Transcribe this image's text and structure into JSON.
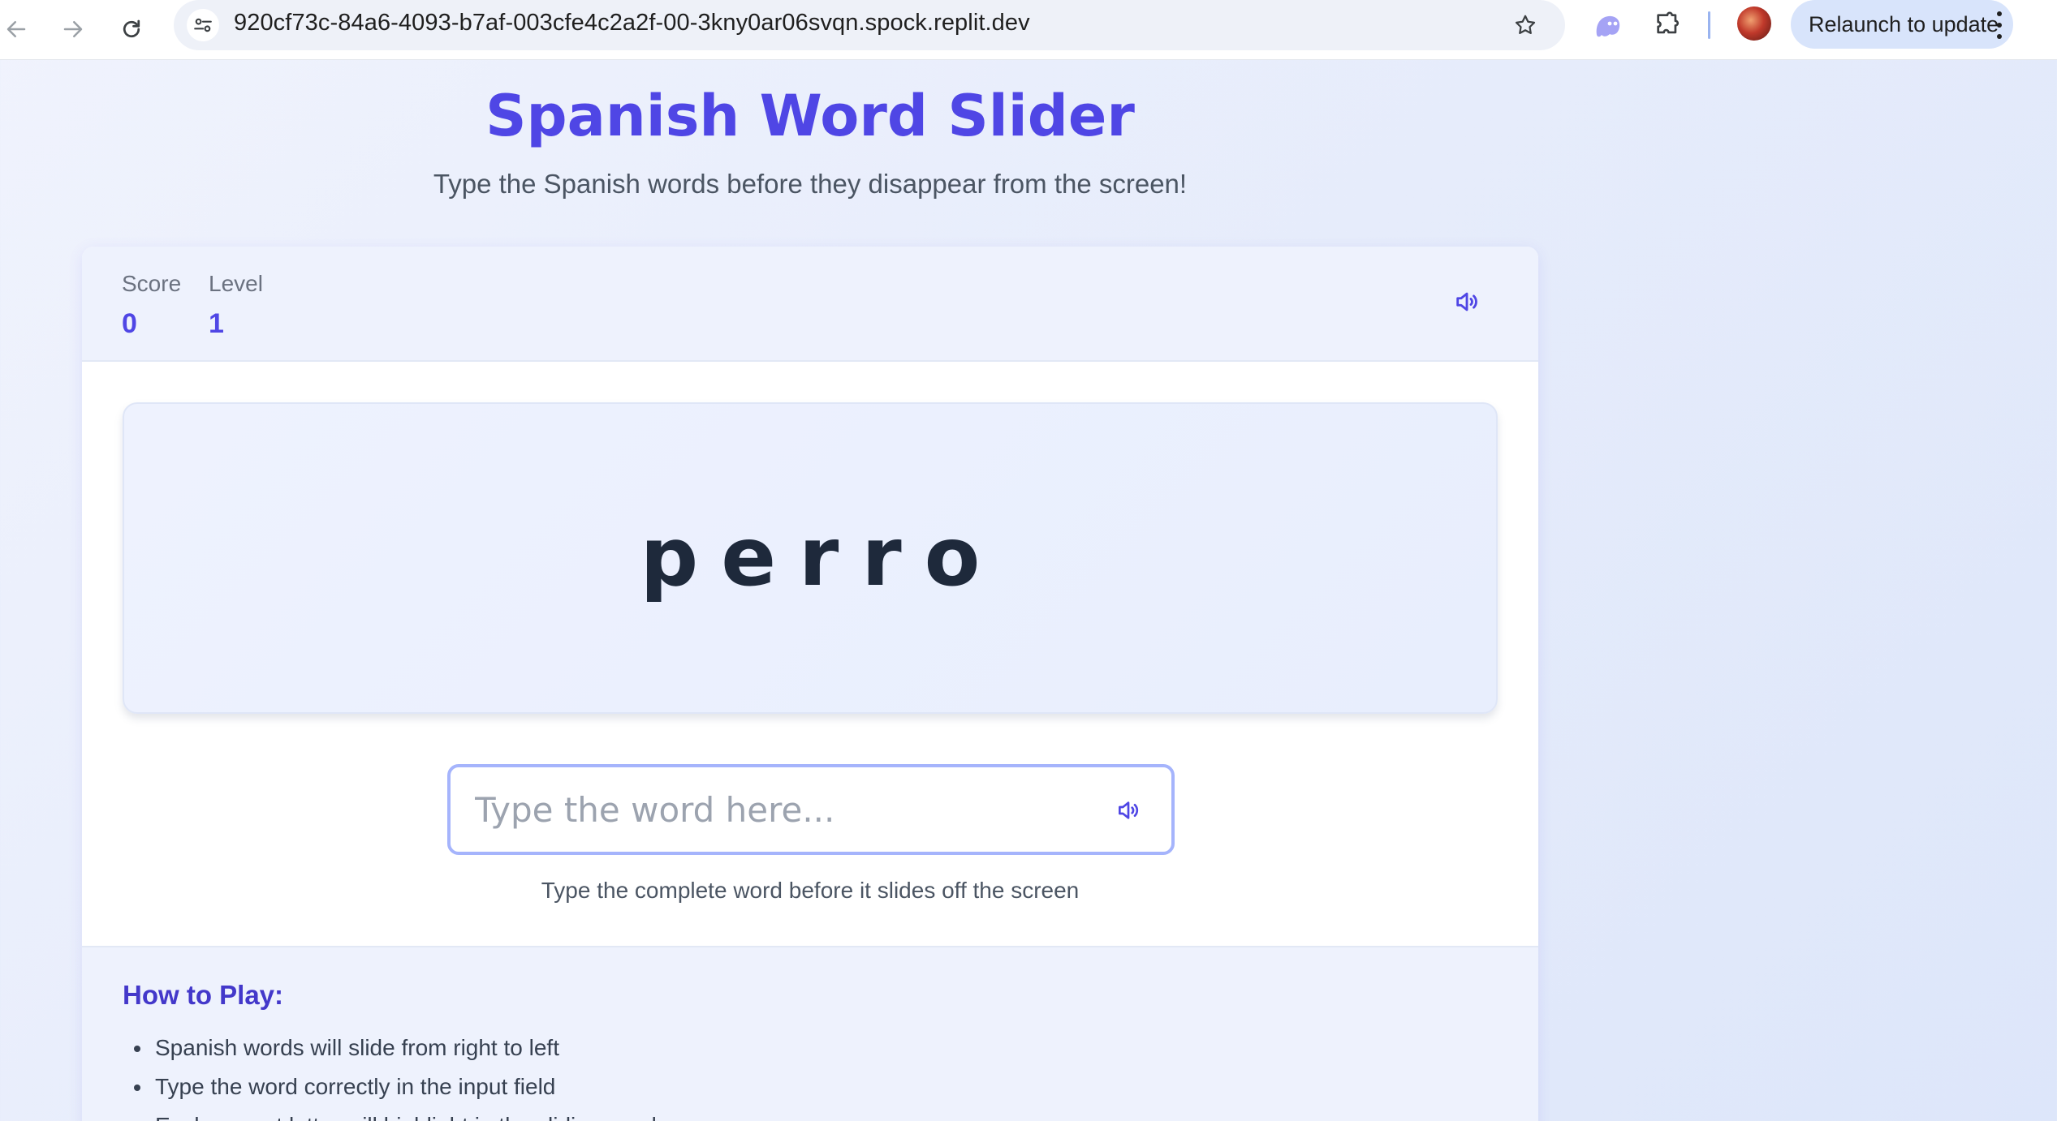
{
  "browser": {
    "url": "920cf73c-84a6-4093-b7af-003cfe4c2a2f-00-3kny0ar06svqn.spock.replit.dev",
    "relaunch_label": "Relaunch to update",
    "icons": [
      "back-arrow-icon",
      "forward-arrow-icon",
      "reload-icon",
      "site-settings-icon",
      "bookmark-star-icon",
      "ghost-extension-icon",
      "extensions-puzzle-icon",
      "profile-avatar",
      "more-vert-icon"
    ]
  },
  "header": {
    "title": "Spanish Word Slider",
    "subtitle": "Type the Spanish words before they disappear from the screen!"
  },
  "stats": {
    "score_label": "Score",
    "score_value": "0",
    "level_label": "Level",
    "level_value": "1"
  },
  "game": {
    "current_word": "perro",
    "input_placeholder": "Type the word here...",
    "input_value": "",
    "hint": "Type the complete word before it slides off the screen"
  },
  "how_to_play": {
    "title": "How to Play:",
    "items": [
      "Spanish words will slide from right to left",
      "Type the word correctly in the input field",
      "Each correct letter will highlight in the sliding word"
    ]
  },
  "colors": {
    "accent": "#4f46e5",
    "accent_dark": "#4338ca",
    "input_border": "#a5b4fc",
    "word_text": "#1e293b"
  }
}
